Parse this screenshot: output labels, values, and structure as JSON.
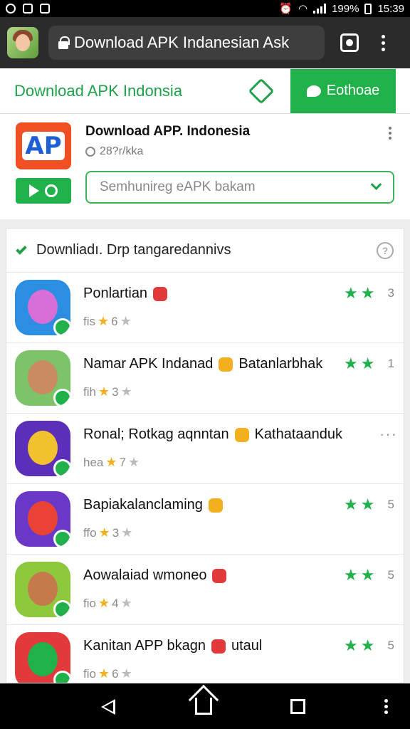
{
  "status_bar": {
    "battery": "199%",
    "time": "15:39"
  },
  "browser": {
    "url": "Download APK Indanesian Ask"
  },
  "site_header": {
    "title": "Download APK Indonsia",
    "button_label": "Eothoae"
  },
  "app_card": {
    "name": "Download APP. Indonesia",
    "subtitle": "28?r/kka",
    "logo_text": "AP",
    "dropdown_value": "Semhunireg eAPK bakam"
  },
  "list": {
    "heading": "Downliadı. Drp tangaredannivs",
    "items": [
      {
        "title": "Ponlartian",
        "meta_prefix": "fis",
        "meta_num": "6",
        "rating_num": "3",
        "colors": {
          "bg": "#2b8ee0",
          "blob": "#d86fd6",
          "tag": "#e23a3a"
        }
      },
      {
        "title": "Namar APK Indanad",
        "title_suffix": "Batanlarbhak",
        "meta_prefix": "fih",
        "meta_num": "3",
        "rating_num": "1",
        "colors": {
          "bg": "#7cc36a",
          "blob": "#c98c62",
          "tag": "#f2b01e"
        }
      },
      {
        "title": "Ronal; Rotkag aqnntan",
        "title_suffix": "Kathataanduk",
        "meta_prefix": "hea",
        "meta_num": "7",
        "rating_num": "",
        "colors": {
          "bg": "#5b2fb8",
          "blob": "#f2c12e",
          "tag": "#f2b01e"
        }
      },
      {
        "title": "Bapiakalanclaming",
        "meta_prefix": "ffo",
        "meta_num": "3",
        "rating_num": "5",
        "colors": {
          "bg": "#6a38c6",
          "blob": "#ea4335",
          "tag": "#f2b01e"
        }
      },
      {
        "title": "Aowalaiad wmoneo",
        "meta_prefix": "fio",
        "meta_num": "4",
        "rating_num": "5",
        "colors": {
          "bg": "#8ec83c",
          "blob": "#c47a4a",
          "tag": "#e23a3a"
        }
      },
      {
        "title": "Kanitan APP bkagn",
        "title_suffix": "utaul",
        "meta_prefix": "fio",
        "meta_num": "6",
        "rating_num": "5",
        "colors": {
          "bg": "#e23a3a",
          "blob": "#21b14b",
          "tag": "#e23a3a"
        }
      }
    ]
  }
}
